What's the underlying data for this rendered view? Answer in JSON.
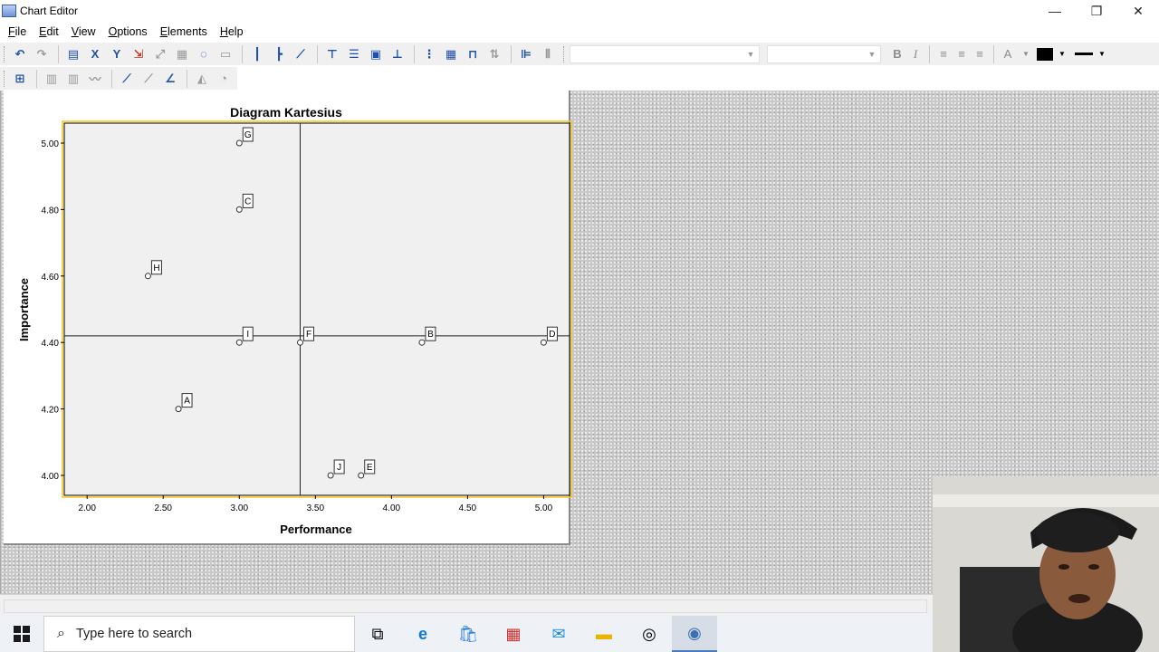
{
  "window": {
    "title": "Chart Editor",
    "controls": [
      "—",
      "❐",
      "✕"
    ]
  },
  "menu": [
    "File",
    "Edit",
    "View",
    "Options",
    "Elements",
    "Help"
  ],
  "format_toolbar": {
    "bold": "B",
    "italic": "I",
    "color_swatch": "#000000"
  },
  "chart_data": {
    "type": "scatter",
    "title": "Diagram Kartesius",
    "xlabel": "Performance",
    "ylabel": "Importance",
    "xlim": [
      1.85,
      5.17
    ],
    "ylim": [
      3.94,
      5.06
    ],
    "xticks": [
      2.0,
      2.5,
      3.0,
      3.5,
      4.0,
      4.5,
      5.0
    ],
    "xtick_labels": [
      "2.00",
      "2.50",
      "3.00",
      "3.50",
      "4.00",
      "4.50",
      "5.00"
    ],
    "yticks": [
      4.0,
      4.2,
      4.4,
      4.6,
      4.8,
      5.0
    ],
    "ytick_labels": [
      "4.00",
      "4.20",
      "4.40",
      "4.60",
      "4.80",
      "5.00"
    ],
    "reference_lines": {
      "x": 3.4,
      "y": 4.42
    },
    "points": [
      {
        "label": "G",
        "x": 3.0,
        "y": 5.0
      },
      {
        "label": "C",
        "x": 3.0,
        "y": 4.8
      },
      {
        "label": "H",
        "x": 2.4,
        "y": 4.6
      },
      {
        "label": "I",
        "x": 3.0,
        "y": 4.4
      },
      {
        "label": "F",
        "x": 3.4,
        "y": 4.4
      },
      {
        "label": "B",
        "x": 4.2,
        "y": 4.4
      },
      {
        "label": "D",
        "x": 5.0,
        "y": 4.4
      },
      {
        "label": "A",
        "x": 2.6,
        "y": 4.2
      },
      {
        "label": "J",
        "x": 3.6,
        "y": 4.0
      },
      {
        "label": "E",
        "x": 3.8,
        "y": 4.0
      }
    ],
    "colors": {
      "plot_bg": "#f0f0f0",
      "axis": "#000000",
      "selection": "#f5c518"
    }
  },
  "statusbar": {
    "text": ""
  },
  "taskbar": {
    "search_placeholder": "Type here to search",
    "apps": [
      "task-view",
      "edge",
      "store",
      "gift",
      "mail",
      "file-explorer",
      "browser",
      "spss"
    ]
  }
}
